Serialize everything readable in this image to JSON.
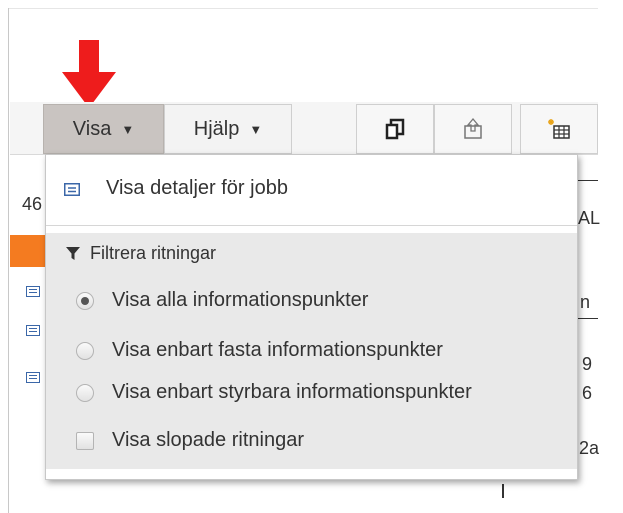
{
  "menubar": {
    "visa_label": "Visa",
    "hjalp_label": "Hjälp",
    "caret": "▼"
  },
  "toolbar": {
    "icons": [
      "copy-window-icon",
      "export-icon",
      "new-table-icon"
    ]
  },
  "dropdown": {
    "details_item": "Visa detaljer för jobb",
    "filter_section_title": "Filtrera ritningar",
    "options": [
      {
        "label": "Visa alla informationspunkter",
        "type": "radio",
        "checked": true
      },
      {
        "label": "Visa enbart fasta informationspunkter",
        "type": "radio",
        "checked": false
      },
      {
        "label": "Visa enbart styrbara informationspunkter",
        "type": "radio",
        "checked": false
      },
      {
        "label": "Visa slopade ritningar",
        "type": "checkbox",
        "checked": false
      }
    ]
  },
  "background": {
    "left_fragment_1": "46",
    "right_fragment_1": "AL",
    "right_fragment_2": "n",
    "right_fragment_3": "9",
    "right_fragment_4": "6",
    "right_fragment_5": "2a"
  },
  "colors": {
    "annotation_arrow": "#ee1c1c",
    "active_menu_bg": "#c9c4c1",
    "status_orange": "#f47b20",
    "accent_blue": "#3b67a8"
  }
}
